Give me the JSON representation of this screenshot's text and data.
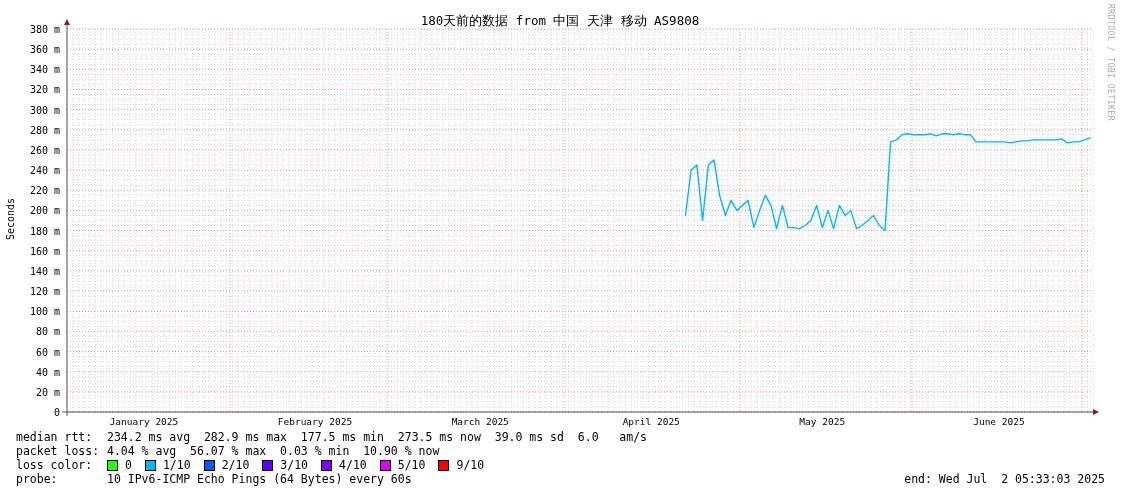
{
  "credit": "RRDTOOL / TOBI OETIKER",
  "chart": {
    "chart_data": {
      "type": "line",
      "grid": true,
      "title": "180天前的数据 from 中国 天津 移动 AS9808",
      "ylabel": "Seconds",
      "ylim": [
        0,
        380
      ],
      "categories": [
        null,
        null,
        null,
        null,
        null,
        null,
        null,
        null,
        null,
        null,
        null,
        null,
        null,
        "January 2025",
        null,
        null,
        null,
        null,
        null,
        null,
        null,
        null,
        null,
        null,
        null,
        null,
        null,
        null,
        null,
        null,
        null,
        null,
        null,
        null,
        null,
        null,
        null,
        null,
        null,
        null,
        null,
        null,
        null,
        "February 2025",
        null,
        null,
        null,
        null,
        null,
        null,
        null,
        null,
        null,
        null,
        null,
        null,
        null,
        null,
        null,
        null,
        null,
        null,
        null,
        null,
        null,
        null,
        null,
        null,
        null,
        null,
        null,
        null,
        "March 2025",
        null,
        null,
        null,
        null,
        null,
        null,
        null,
        null,
        null,
        null,
        null,
        null,
        null,
        null,
        null,
        null,
        null,
        null,
        null,
        null,
        null,
        null,
        null,
        null,
        null,
        null,
        null,
        null,
        null,
        "April 2025",
        null,
        null,
        null,
        null,
        null,
        null,
        null,
        null,
        null,
        null,
        null,
        null,
        null,
        null,
        null,
        null,
        null,
        null,
        null,
        null,
        null,
        null,
        null,
        null,
        null,
        null,
        null,
        null,
        null,
        "May 2025",
        null,
        null,
        null,
        null,
        null,
        null,
        null,
        null,
        null,
        null,
        null,
        null,
        null,
        null,
        null,
        null,
        null,
        null,
        null,
        null,
        null,
        null,
        null,
        null,
        null,
        null,
        null,
        null,
        null,
        null,
        "June 2025",
        null,
        null,
        null,
        null,
        null,
        null,
        null,
        null,
        null,
        null,
        null,
        null,
        null,
        null,
        null,
        null
      ],
      "yticks": [
        {
          "value": 0,
          "label": "0"
        },
        {
          "value": 20,
          "label": "20 m"
        },
        {
          "value": 40,
          "label": "40 m"
        },
        {
          "value": 60,
          "label": "60 m"
        },
        {
          "value": 80,
          "label": "80 m"
        },
        {
          "value": 100,
          "label": "100 m"
        },
        {
          "value": 120,
          "label": "120 m"
        },
        {
          "value": 140,
          "label": "140 m"
        },
        {
          "value": 160,
          "label": "160 m"
        },
        {
          "value": 180,
          "label": "180 m"
        },
        {
          "value": 200,
          "label": "200 m"
        },
        {
          "value": 220,
          "label": "220 m"
        },
        {
          "value": 240,
          "label": "240 m"
        },
        {
          "value": 260,
          "label": "260 m"
        },
        {
          "value": 280,
          "label": "280 m"
        },
        {
          "value": 300,
          "label": "300 m"
        },
        {
          "value": 320,
          "label": "320 m"
        },
        {
          "value": 340,
          "label": "340 m"
        },
        {
          "value": 360,
          "label": "360 m"
        },
        {
          "value": 380,
          "label": "380 m"
        }
      ],
      "series": [
        {
          "color": "#00b8ff",
          "values": [
            null,
            null,
            null,
            null,
            null,
            null,
            null,
            null,
            null,
            null,
            null,
            null,
            null,
            null,
            null,
            null,
            null,
            null,
            null,
            null,
            null,
            null,
            null,
            null,
            null,
            null,
            null,
            null,
            null,
            null,
            null,
            null,
            null,
            null,
            null,
            null,
            null,
            null,
            null,
            null,
            null,
            null,
            null,
            null,
            null,
            null,
            null,
            null,
            null,
            null,
            null,
            null,
            null,
            null,
            null,
            null,
            null,
            null,
            null,
            null,
            null,
            null,
            null,
            null,
            null,
            null,
            null,
            null,
            null,
            null,
            null,
            null,
            null,
            null,
            null,
            null,
            null,
            null,
            null,
            null,
            null,
            null,
            null,
            null,
            null,
            null,
            null,
            null,
            null,
            null,
            null,
            null,
            null,
            null,
            null,
            null,
            null,
            null,
            null,
            null,
            null,
            null,
            null,
            null,
            null,
            null,
            null,
            null,
            195,
            240,
            245,
            190,
            245,
            250,
            215,
            195,
            210,
            200,
            205,
            210,
            183,
            200,
            215,
            205,
            182,
            205,
            183,
            183,
            182,
            185,
            190,
            205,
            183,
            200,
            182,
            205,
            195,
            200,
            182,
            185,
            190,
            195,
            185,
            180,
            268,
            270,
            275,
            276,
            275,
            275,
            275,
            276,
            274,
            276,
            276,
            275,
            276,
            275,
            275,
            268,
            268,
            268,
            268,
            268,
            268,
            267,
            268,
            269,
            269,
            270,
            270,
            270,
            270,
            270,
            271,
            267,
            268,
            268,
            270,
            272
          ]
        }
      ]
    }
  },
  "legend": {
    "rows": [
      {
        "label": "median rtt:",
        "text": "234.2 ms avg  282.9 ms max  177.5 ms min  273.5 ms now  39.0 ms sd  6.0   am/s"
      },
      {
        "label": "packet loss:",
        "text": "4.04 % avg  56.07 % max  0.03 % min  10.90 % now"
      }
    ],
    "loss_label": "loss color:",
    "loss_colors": [
      {
        "label": "0",
        "color": "#26ff00"
      },
      {
        "label": "1/10",
        "color": "#00b8ff"
      },
      {
        "label": "2/10",
        "color": "#0059ff"
      },
      {
        "label": "3/10",
        "color": "#5e00ff"
      },
      {
        "label": "4/10",
        "color": "#7e00ff"
      },
      {
        "label": "5/10",
        "color": "#dd00ff"
      },
      {
        "label": "9/10",
        "color": "#ff0000"
      }
    ],
    "probe_label": "probe:",
    "probe": "10 IPv6-ICMP Echo Pings (64 Bytes) every 60s",
    "end": "end: Wed Jul  2 05:33:03 2025"
  }
}
